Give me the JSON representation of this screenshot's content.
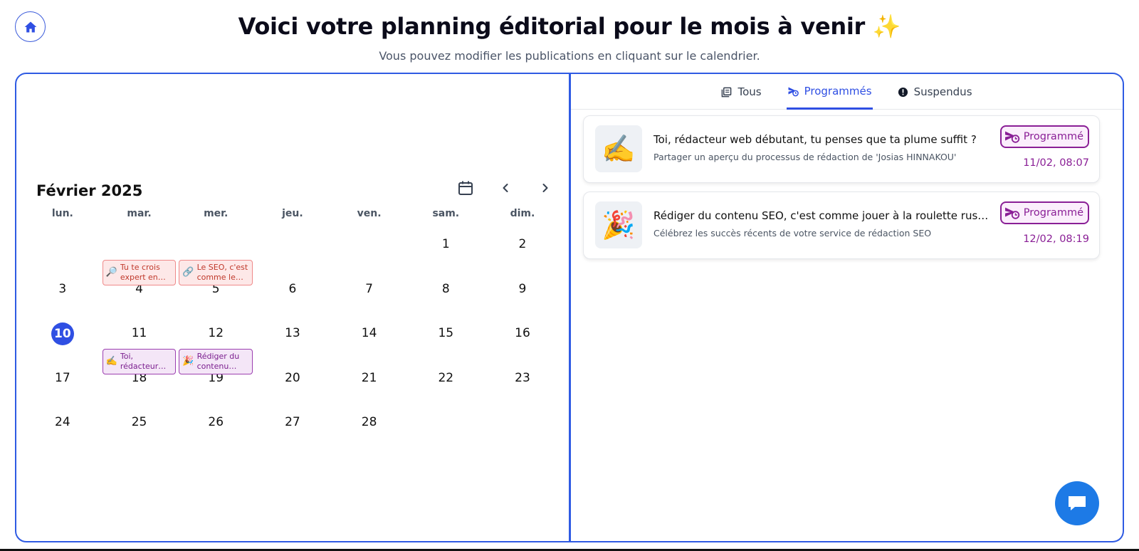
{
  "header": {
    "title": "Voici votre planning éditorial pour le mois à venir ✨",
    "subtitle": "Vous pouvez modifier les publications en cliquant sur le calendrier."
  },
  "calendar": {
    "month_label": "Février 2025",
    "weekdays": [
      "lun.",
      "mar.",
      "mer.",
      "jeu.",
      "ven.",
      "sam.",
      "dim."
    ],
    "weeks": [
      [
        "",
        "",
        "",
        "",
        "",
        "1",
        "2"
      ],
      [
        "3",
        "4",
        "5",
        "6",
        "7",
        "8",
        "9"
      ],
      [
        "10",
        "11",
        "12",
        "13",
        "14",
        "15",
        "16"
      ],
      [
        "17",
        "18",
        "19",
        "20",
        "21",
        "22",
        "23"
      ],
      [
        "24",
        "25",
        "26",
        "27",
        "28",
        "",
        ""
      ]
    ],
    "today": "10",
    "events": [
      {
        "week": 1,
        "col": 1,
        "emoji": "🔎",
        "text": "Tu te crois expert en SEO ...",
        "kind": "warn"
      },
      {
        "week": 1,
        "col": 2,
        "emoji": "🔗",
        "text": "Le SEO, c'est comme le sexe...",
        "kind": "warn"
      },
      {
        "week": 3,
        "col": 1,
        "emoji": "✍️",
        "text": "Toi, rédacteur web débutant,...",
        "kind": "sched"
      },
      {
        "week": 3,
        "col": 2,
        "emoji": "🎉",
        "text": "Rédiger du contenu SEO, ...",
        "kind": "sched"
      }
    ]
  },
  "tabs": [
    {
      "label": "Tous",
      "icon": "list-icon",
      "active": false
    },
    {
      "label": "Programmés",
      "icon": "scheduled-send-icon",
      "active": true
    },
    {
      "label": "Suspendus",
      "icon": "alert-circle-icon",
      "active": false
    }
  ],
  "posts": [
    {
      "emoji": "✍️",
      "title": "Toi, rédacteur web débutant, tu penses que ta plume suffit ?",
      "description": "Partager un aperçu du processus de rédaction de 'Josias HINNAKOU'",
      "status": "Programmé",
      "date": "11/02, 08:07"
    },
    {
      "emoji": "🎉",
      "title": "Rédiger du contenu SEO, c'est comme jouer à la roulette russe ave…",
      "description": "Célébrez les succès récents de votre service de rédaction SEO",
      "status": "Programmé",
      "date": "12/02, 08:19"
    }
  ],
  "colors": {
    "accent": "#2f4fe3",
    "scheduled": "#8a1f96",
    "warning": "#c0392b",
    "chat": "#1d7ae6"
  }
}
